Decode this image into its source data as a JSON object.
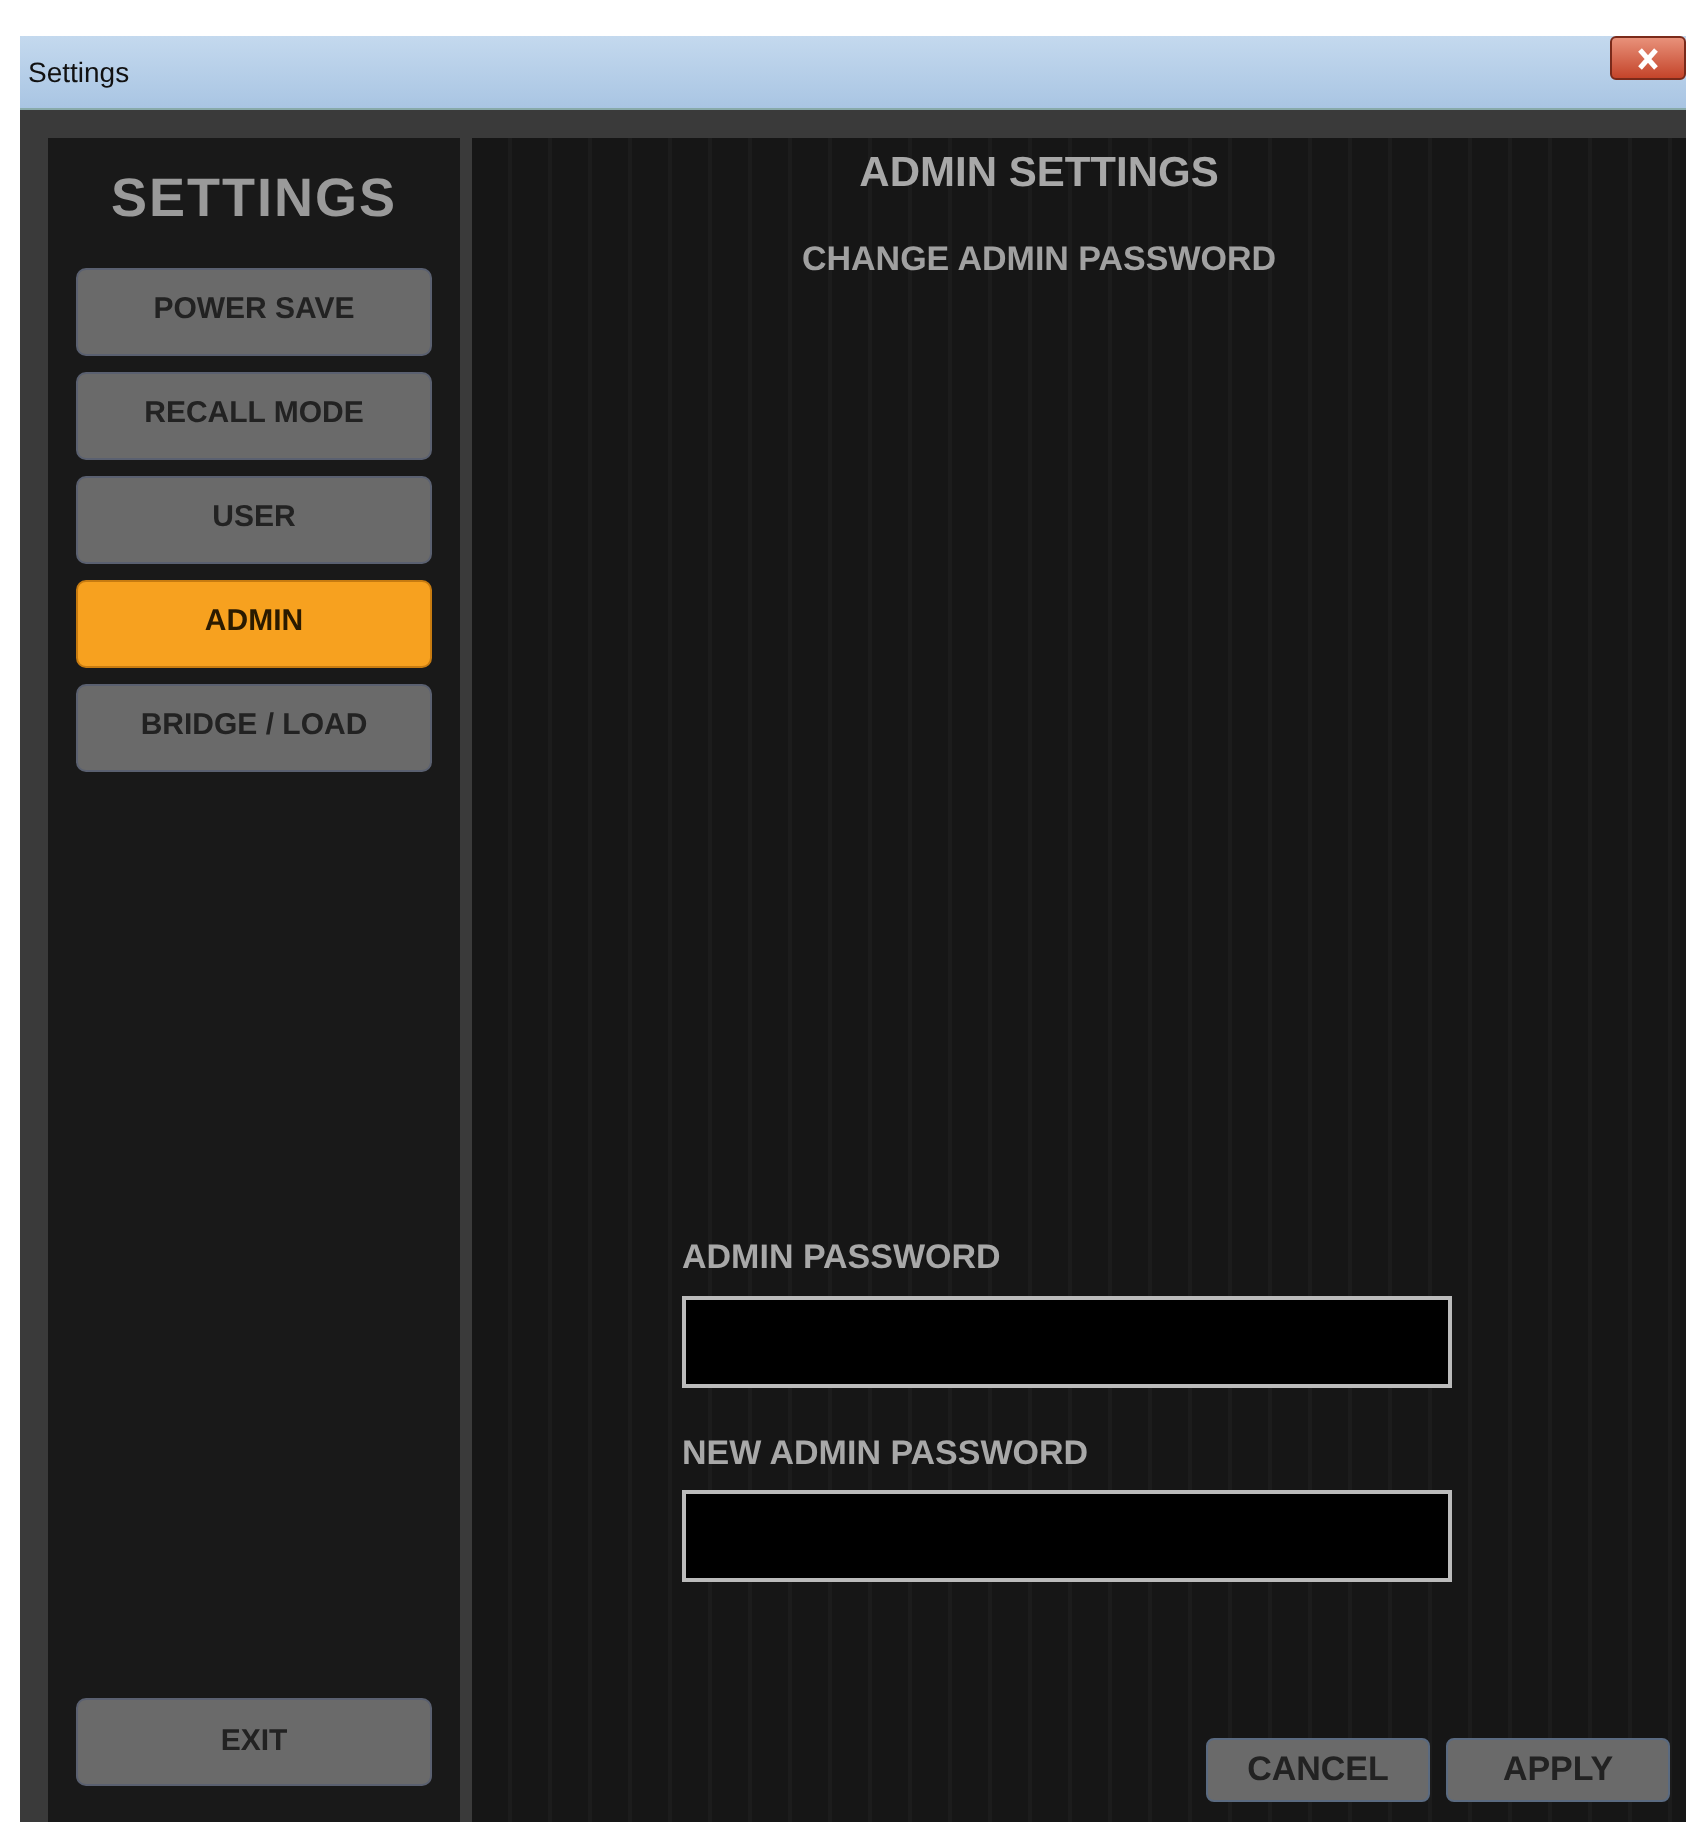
{
  "window": {
    "title": "Settings"
  },
  "sidebar": {
    "title": "SETTINGS",
    "items": [
      {
        "label": "POWER SAVE",
        "selected": false
      },
      {
        "label": "RECALL MODE",
        "selected": false
      },
      {
        "label": "USER",
        "selected": false
      },
      {
        "label": "ADMIN",
        "selected": true
      },
      {
        "label": "BRIDGE / LOAD",
        "selected": false
      }
    ],
    "exit": "EXIT"
  },
  "main": {
    "title": "ADMIN SETTINGS",
    "subtitle": "CHANGE ADMIN PASSWORD",
    "fields": [
      {
        "label": "ADMIN PASSWORD"
      },
      {
        "label": "NEW ADMIN PASSWORD"
      }
    ],
    "buttons": [
      "CANCEL",
      "APPLY"
    ]
  }
}
